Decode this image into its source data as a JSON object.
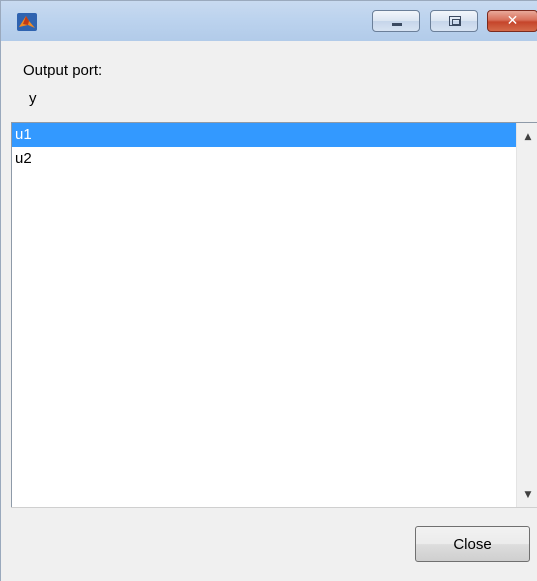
{
  "window": {
    "title": "",
    "icon": "matlab-icon",
    "controls": {
      "minimize_icon": "minimize-icon",
      "maximize_icon": "maximize-icon",
      "close_glyph": "✕"
    },
    "accent_color": "#3399ff"
  },
  "header": {
    "label": "Output port:",
    "value": "y"
  },
  "list": {
    "items": [
      {
        "label": "u1",
        "selected": true
      },
      {
        "label": "u2",
        "selected": false
      }
    ],
    "scroll_up_glyph": "▲",
    "scroll_down_glyph": "▼"
  },
  "footer": {
    "close_label": "Close"
  }
}
